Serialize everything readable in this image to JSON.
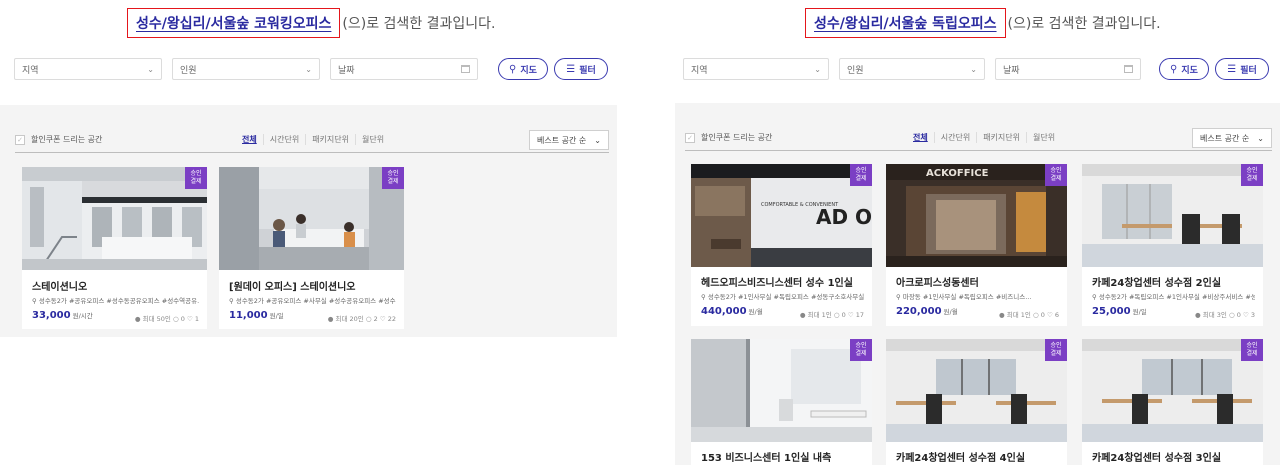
{
  "left": {
    "keyword": "성수/왕십리/서울숲 코워킹오피스",
    "suffix": "(으)로 검색한 결과입니다.",
    "filters": {
      "region": "지역",
      "people": "인원",
      "date": "날짜"
    },
    "buttons": {
      "map": "지도",
      "filter": "필터"
    },
    "coupon_label": "할인쿠폰 드리는 공간",
    "tabs": [
      "전체",
      "시간단위",
      "패키지단위",
      "월단위"
    ],
    "sort": "베스트 공간 순",
    "cards": [
      {
        "badge_line1": "승인",
        "badge_line2": "결제",
        "title": "스테이션니오",
        "location": "성수동2가",
        "tags": "#공유오피스 #성수동공유오피스 #성수역공유...",
        "price": "33,000",
        "unit": "원/시간",
        "capacity": "최대 50인",
        "reviews": "0",
        "likes": "1"
      },
      {
        "badge_line1": "승인",
        "badge_line2": "결제",
        "title": "[원데이 오피스] 스테이션니오",
        "location": "성수동2가",
        "tags": "#공유오피스 #사무실 #성수공유오피스 #성수...",
        "price": "11,000",
        "unit": "원/일",
        "capacity": "최대 20인",
        "reviews": "2",
        "likes": "22"
      }
    ]
  },
  "right": {
    "keyword": "성수/왕십리/서울숲 독립오피스",
    "suffix": "(으)로 검색한 결과입니다.",
    "filters": {
      "region": "지역",
      "people": "인원",
      "date": "날짜"
    },
    "buttons": {
      "map": "지도",
      "filter": "필터"
    },
    "coupon_label": "할인쿠폰 드리는 공간",
    "tabs": [
      "전체",
      "시간단위",
      "패키지단위",
      "월단위"
    ],
    "sort": "베스트 공간 순",
    "cards": [
      {
        "badge_line1": "승인",
        "badge_line2": "결제",
        "title": "헤드오피스비즈니스센터 성수 1인실",
        "location": "성수동2가",
        "tags": "#1인사무실 #독립오피스 #성동구소호사무실...",
        "price": "440,000",
        "unit": "원/월",
        "capacity": "최대 1인",
        "reviews": "0",
        "likes": "17"
      },
      {
        "badge_line1": "승인",
        "badge_line2": "결제",
        "title": "아크로피스성동센터",
        "location": "마장동",
        "tags": "#1인사무실 #독립오피스 #비즈니스...",
        "price": "220,000",
        "unit": "원/월",
        "capacity": "최대 1인",
        "reviews": "0",
        "likes": "6"
      },
      {
        "badge_line1": "승인",
        "badge_line2": "결제",
        "title": "카페24창업센터 성수점 2인실",
        "location": "성수동2가",
        "tags": "#독립오피스 #1인사무실 #비상주서비스 #성...",
        "price": "25,000",
        "unit": "원/일",
        "capacity": "최대 3인",
        "reviews": "0",
        "likes": "3"
      },
      {
        "badge_line1": "승인",
        "badge_line2": "결제",
        "title": "153 비즈니스센터 1인실 내측"
      },
      {
        "badge_line1": "승인",
        "badge_line2": "결제",
        "title": "카페24창업센터 성수점 4인실"
      },
      {
        "badge_line1": "승인",
        "badge_line2": "결제",
        "title": "카페24창업센터 성수점 3인실"
      }
    ],
    "sign_text": "ACKOFFICE"
  }
}
